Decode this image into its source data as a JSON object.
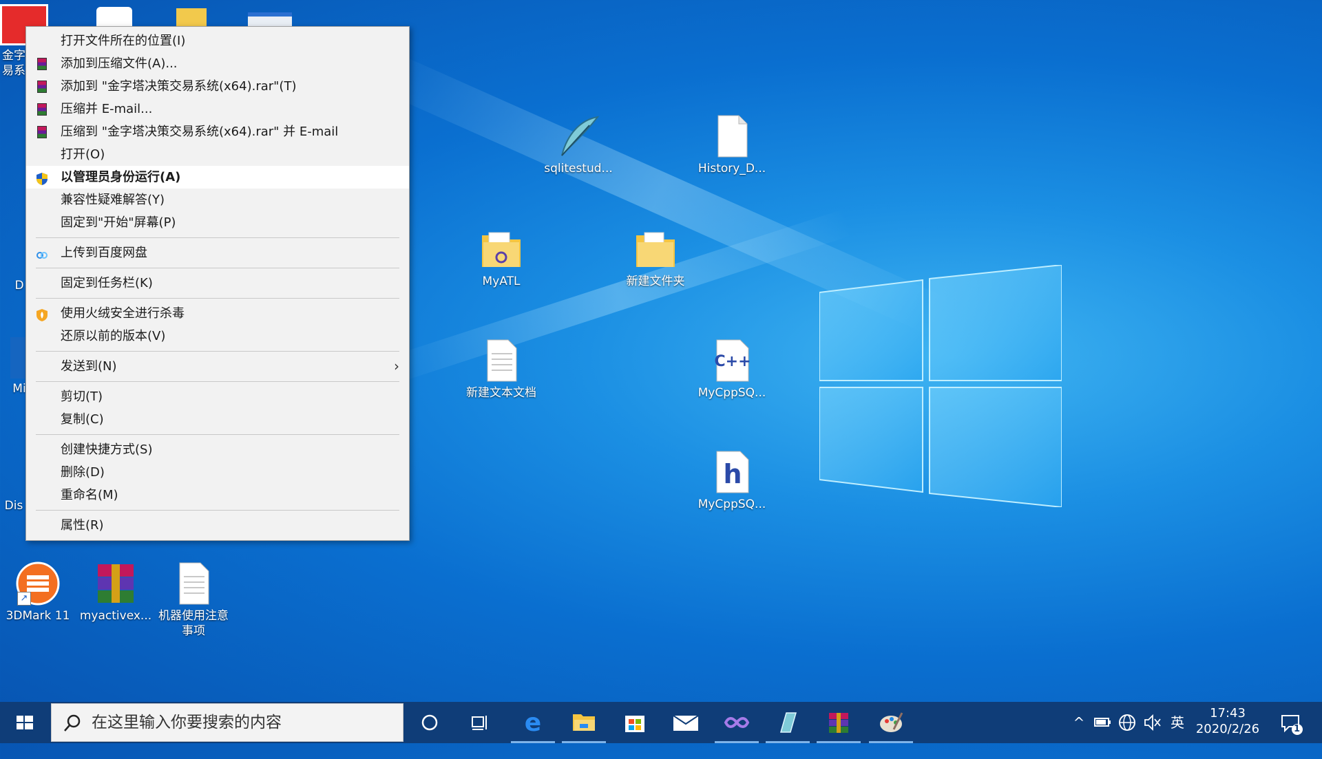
{
  "desktop": {
    "icons": [
      {
        "label": "金字 易系",
        "icon": "app-shortcut-icon"
      },
      {
        "label": "3DMark 11",
        "icon": "3dmark-icon"
      },
      {
        "label": "myactivex...",
        "icon": "winrar-archive-icon"
      },
      {
        "label": "机器使用注意事项",
        "icon": "text-document-icon"
      },
      {
        "label": "sqlitestud...",
        "icon": "feather-icon"
      },
      {
        "label": "History_D...",
        "icon": "blank-file-icon"
      },
      {
        "label": "MyATL",
        "icon": "folder-icon"
      },
      {
        "label": "新建文件夹",
        "icon": "folder-icon"
      },
      {
        "label": "新建文本文档",
        "icon": "text-document-icon"
      },
      {
        "label": "MyCppSQ...",
        "icon": "cpp-file-icon"
      },
      {
        "label": "MyCppSQ...",
        "icon": "header-file-icon"
      },
      {
        "label": "Mi",
        "icon": "app-shortcut-icon"
      },
      {
        "label": "Dis",
        "icon": "app-shortcut-icon"
      },
      {
        "label": "D",
        "icon": "recycle-bin-icon"
      }
    ]
  },
  "menu": {
    "items": [
      {
        "label": "打开文件所在的位置(I)"
      },
      {
        "label": "添加到压缩文件(A)...",
        "icon": "winrar-icon"
      },
      {
        "label": "添加到 \"金字塔决策交易系统(x64).rar\"(T)",
        "icon": "winrar-icon"
      },
      {
        "label": "压缩并 E-mail...",
        "icon": "winrar-icon"
      },
      {
        "label": "压缩到 \"金字塔决策交易系统(x64).rar\" 并 E-mail",
        "icon": "winrar-icon"
      },
      {
        "label": "打开(O)"
      },
      {
        "label": "以管理员身份运行(A)",
        "icon": "uac-shield-icon",
        "highlighted": true
      },
      {
        "label": "兼容性疑难解答(Y)"
      },
      {
        "label": "固定到\"开始\"屏幕(P)"
      },
      {
        "label": "上传到百度网盘",
        "icon": "baidu-netdisk-icon"
      },
      {
        "label": "固定到任务栏(K)"
      },
      {
        "label": "使用火绒安全进行杀毒",
        "icon": "huorong-shield-icon"
      },
      {
        "label": "还原以前的版本(V)"
      },
      {
        "label": "发送到(N)",
        "submenu": true
      },
      {
        "label": "剪切(T)"
      },
      {
        "label": "复制(C)"
      },
      {
        "label": "创建快捷方式(S)"
      },
      {
        "label": "删除(D)"
      },
      {
        "label": "重命名(M)"
      },
      {
        "label": "属性(R)"
      }
    ]
  },
  "taskbar": {
    "search_placeholder": "在这里输入你要搜索的内容",
    "apps": [
      "cortana-icon",
      "task-view-icon",
      "edge-icon",
      "file-explorer-icon",
      "store-icon",
      "mail-icon",
      "visual-studio-icon",
      "sqlite-icon",
      "winrar-icon",
      "paint-icon"
    ],
    "tray": {
      "ime": "英",
      "time": "17:43",
      "date": "2020/2/26",
      "notification_count": "1"
    }
  },
  "colors": {
    "accent": "#0a6fd0",
    "taskbar": "#0f3d78",
    "menu_bg": "#f2f2f2"
  }
}
